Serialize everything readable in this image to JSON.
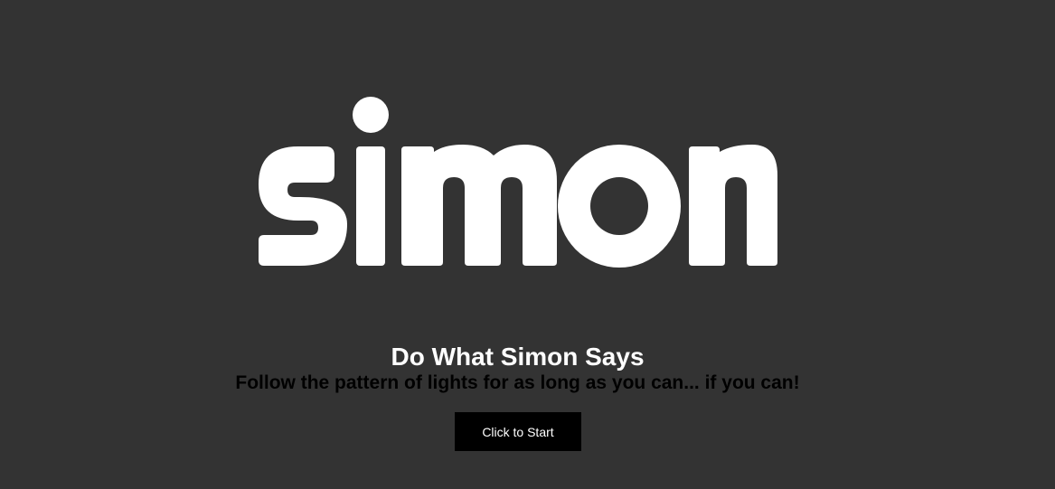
{
  "logo": {
    "text": "simon",
    "color": "#ffffff"
  },
  "game": {
    "title": "Do What Simon Says",
    "instructions": "Follow the pattern of lights for as long as you can... if you can!",
    "start_label": "Click to Start"
  },
  "colors": {
    "background": "#333333",
    "button_background": "#000000",
    "button_text": "#ffffff",
    "title_text": "#ffffff",
    "instructions_text": "#000000"
  }
}
